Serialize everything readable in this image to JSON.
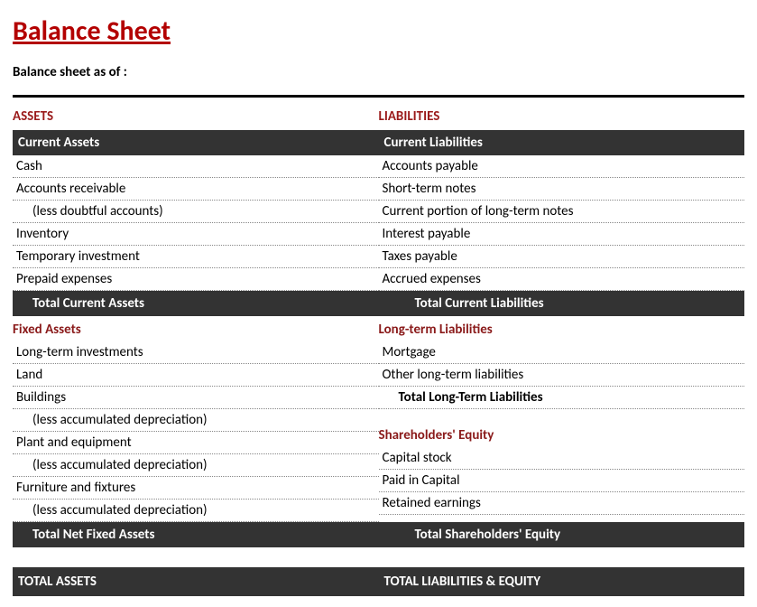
{
  "title": "Balance Sheet",
  "subtitle": "Balance sheet as of :",
  "left": {
    "heading": "ASSETS",
    "current": {
      "header": "Current Assets",
      "items": [
        "Cash",
        "Accounts receivable",
        "(less doubtful accounts)",
        "Inventory",
        "Temporary investment",
        "Prepaid expenses"
      ],
      "total": "Total Current Assets"
    },
    "fixed": {
      "header": "Fixed Assets",
      "items": [
        "Long-term investments",
        "Land",
        "Buildings",
        "(less accumulated depreciation)",
        "Plant and equipment",
        "(less accumulated depreciation)",
        "Furniture and fixtures",
        "(less accumulated depreciation)"
      ],
      "total": "Total Net Fixed Assets"
    },
    "grand_total": "TOTAL ASSETS"
  },
  "right": {
    "heading": "LIABILITIES",
    "current": {
      "header": "Current Liabilities",
      "items": [
        "Accounts payable",
        "Short-term notes",
        "Current portion of long-term notes",
        "Interest payable",
        "Taxes payable",
        "Accrued expenses"
      ],
      "total": "Total Current Liabilities"
    },
    "longterm": {
      "header": "Long-term Liabilities",
      "items": [
        "Mortgage",
        "Other long-term liabilities"
      ],
      "total": "Total Long-Term Liabilities"
    },
    "equity": {
      "header": "Shareholders' Equity",
      "items": [
        "Capital stock",
        "Paid in Capital",
        "Retained earnings"
      ],
      "total": "Total Shareholders' Equity"
    },
    "grand_total": "TOTAL LIABILITIES & EQUITY"
  }
}
